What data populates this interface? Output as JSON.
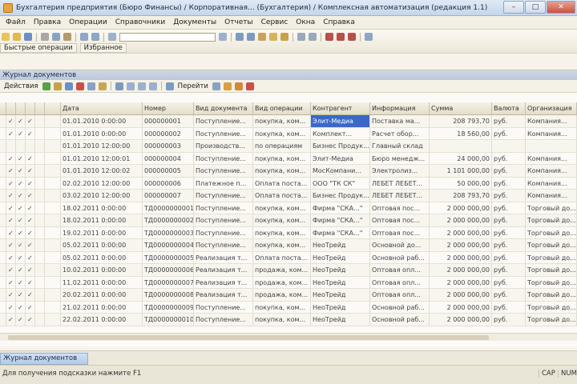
{
  "window": {
    "title": "Бухгалтерия предприятия (Бюро Финансы) / Корпоративная... (Бухгалтерия) / Комплексная автоматизация (редакция 1.1)",
    "icons": {
      "app": "app-1c-icon",
      "min": "minimize-icon",
      "max": "maximize-icon",
      "close": "close-icon"
    },
    "controls": {
      "min": "–",
      "max": "□",
      "close": "✕"
    }
  },
  "menu": [
    "Файл",
    "Правка",
    "Операции",
    "Справочники",
    "Документы",
    "Отчеты",
    "Сервис",
    "Окна",
    "Справка"
  ],
  "toolbar": {
    "quick_ops_label": "Быстрые операции",
    "favorites_label": "Избранное"
  },
  "panel": {
    "title": "Журнал документов",
    "actions_label": "Действия",
    "go_label": "Перейти"
  },
  "grid": {
    "columns": [
      "",
      "",
      "",
      "",
      "",
      "",
      "Дата",
      "Номер",
      "Вид документа",
      "Вид операции",
      "Контрагент",
      "Информация",
      "Сумма",
      "Валюта",
      "Организация"
    ],
    "rows": [
      {
        "flags": [
          "✓",
          "✓",
          "✓"
        ],
        "date": "01.01.2010 0:00:00",
        "number": "000000001",
        "kind": "Поступление...",
        "op": "покупка, ком...",
        "agent": "Элит-Медиа",
        "info": "Поставка ма...",
        "sum": "208 793,70",
        "cur": "руб.",
        "org": "Компания..."
      },
      {
        "flags": [
          "✓",
          "✓",
          "✓"
        ],
        "date": "01.01.2010 0:00:00",
        "number": "000000002",
        "kind": "Поступление...",
        "op": "покупка, ком...",
        "agent": "Комплект...",
        "info": "Расчет обор...",
        "sum": "18 560,00",
        "cur": "руб.",
        "org": "Компания..."
      },
      {
        "flags": [
          "",
          "",
          ""
        ],
        "date": "01.01.2010 12:00:00",
        "number": "000000003",
        "kind": "Производств...",
        "op": "по операциям",
        "agent": "Бизнес Продук...",
        "info": "Главный склад",
        "sum": "",
        "cur": "",
        "org": ""
      },
      {
        "flags": [
          "✓",
          "✓",
          "✓"
        ],
        "date": "01.01.2010 12:00:01",
        "number": "000000004",
        "kind": "Поступление...",
        "op": "покупка, ком...",
        "agent": "Элит-Медиа",
        "info": "Бюро менедж...",
        "sum": "24 000,00",
        "cur": "руб.",
        "org": "Компания..."
      },
      {
        "flags": [
          "✓",
          "✓",
          "✓"
        ],
        "date": "01.01.2010 12:00:02",
        "number": "000000005",
        "kind": "Поступление...",
        "op": "покупка, ком...",
        "agent": "МосКомпани...",
        "info": "Электролиз...",
        "sum": "1 101 000,00",
        "cur": "руб.",
        "org": "Компания..."
      },
      {
        "flags": [
          "✓",
          "✓",
          "✓"
        ],
        "date": "02.02.2010 12:00:00",
        "number": "000000006",
        "kind": "Платежное п...",
        "op": "Оплата поста...",
        "agent": "ООО \"ТК СК\"",
        "info": "ЛЕБЕТ ЛЕБЕТ...",
        "sum": "50 000,00",
        "cur": "руб.",
        "org": "Компания..."
      },
      {
        "flags": [
          "✓",
          "✓",
          "✓"
        ],
        "date": "03.02.2010 12:00:00",
        "number": "000000007",
        "kind": "Поступление...",
        "op": "Оплата поста...",
        "agent": "Бизнес Продук...",
        "info": "ЛЕБЕТ ЛЕБЕТ...",
        "sum": "208 793,70",
        "cur": "руб.",
        "org": "Компания..."
      },
      {
        "flags": [
          "✓",
          "✓",
          "✓"
        ],
        "date": "18.02.2011 0:00:00",
        "number": "ТД0000000001",
        "kind": "Поступление...",
        "op": "покупка, ком...",
        "agent": "Фирма \"СКА...\"",
        "info": "Оптовая пос...",
        "sum": "2 000 000,00",
        "cur": "руб.",
        "org": "Торговый до..."
      },
      {
        "flags": [
          "✓",
          "✓",
          "✓"
        ],
        "date": "18.02.2011 0:00:00",
        "number": "ТД0000000002",
        "kind": "Поступление...",
        "op": "покупка, ком...",
        "agent": "Фирма \"СКА...\"",
        "info": "Оптовая пос...",
        "sum": "2 000 000,00",
        "cur": "руб.",
        "org": "Торговый до..."
      },
      {
        "flags": [
          "✓",
          "✓",
          "✓"
        ],
        "date": "19.02.2011 0:00:00",
        "number": "ТД0000000003",
        "kind": "Поступление...",
        "op": "покупка, ком...",
        "agent": "Фирма \"СКА...\"",
        "info": "Оптовая пос...",
        "sum": "2 000 000,00",
        "cur": "руб.",
        "org": "Торговый до..."
      },
      {
        "flags": [
          "✓",
          "✓",
          "✓"
        ],
        "date": "05.02.2011 0:00:00",
        "number": "ТД0000000004",
        "kind": "Поступление...",
        "op": "покупка, ком...",
        "agent": "НеоТрейд",
        "info": "Основной до...",
        "sum": "2 000 000,00",
        "cur": "руб.",
        "org": "Торговый до..."
      },
      {
        "flags": [
          "✓",
          "✓",
          "✓"
        ],
        "date": "05.02.2011 0:00:00",
        "number": "ТД0000000005",
        "kind": "Реализация т...",
        "op": "Оплата поста...",
        "agent": "НеоТрейд",
        "info": "Основной раб...",
        "sum": "2 000 000,00",
        "cur": "руб.",
        "org": "Торговый до..."
      },
      {
        "flags": [
          "✓",
          "✓",
          "✓"
        ],
        "date": "10.02.2011 0:00:00",
        "number": "ТД0000000006",
        "kind": "Реализация т...",
        "op": "продажа, ком...",
        "agent": "НеоТрейд",
        "info": "Оптовая опл...",
        "sum": "2 000 000,00",
        "cur": "руб.",
        "org": "Торговый до..."
      },
      {
        "flags": [
          "✓",
          "✓",
          "✓"
        ],
        "date": "11.02.2011 0:00:00",
        "number": "ТД0000000007",
        "kind": "Реализация т...",
        "op": "продажа, ком...",
        "agent": "НеоТрейд",
        "info": "Оптовая опл...",
        "sum": "2 000 000,00",
        "cur": "руб.",
        "org": "Торговый до..."
      },
      {
        "flags": [
          "✓",
          "✓",
          "✓"
        ],
        "date": "20.02.2011 0:00:00",
        "number": "ТД0000000008",
        "kind": "Реализация т...",
        "op": "продажа, ком...",
        "agent": "НеоТрейд",
        "info": "Оптовая опл...",
        "sum": "2 000 000,00",
        "cur": "руб.",
        "org": "Торговый до..."
      },
      {
        "flags": [
          "✓",
          "✓",
          "✓"
        ],
        "date": "21.02.2011 0:00:00",
        "number": "ТД0000000009",
        "kind": "Поступление...",
        "op": "покупка, ком...",
        "agent": "НеоТрейд",
        "info": "Основной раб...",
        "sum": "2 000 000,00",
        "cur": "руб.",
        "org": "Торговый до..."
      },
      {
        "flags": [
          "✓",
          "✓",
          "✓"
        ],
        "date": "22.02.2011 0:00:00",
        "number": "ТД0000000010",
        "kind": "Поступление...",
        "op": "покупка, ком...",
        "agent": "НеоТрейд",
        "info": "Основной раб...",
        "sum": "2 000 000,00",
        "cur": "руб.",
        "org": "Торговый до..."
      }
    ]
  },
  "bottom_tab": "Журнал документов",
  "status": {
    "hint": "Для получения подсказки нажмите F1",
    "cap": "CAP",
    "num": "NUM"
  },
  "colors": {
    "selection": "#3a68c8",
    "panel_header": "#c3d0e1"
  }
}
